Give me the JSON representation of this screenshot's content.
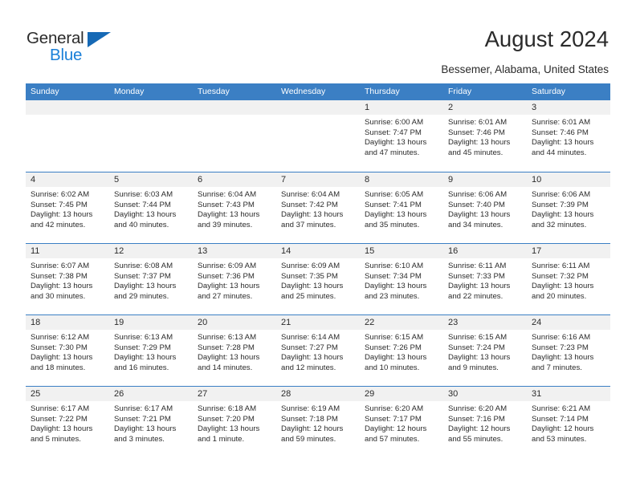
{
  "brand": {
    "name_top": "General",
    "name_bottom": "Blue",
    "triangle_color": "#1669b5",
    "blue_text_color": "#1b80d8"
  },
  "header": {
    "title": "August 2024",
    "subtitle": "Bessemer, Alabama, United States"
  },
  "theme": {
    "header_blue": "#3b7fc4",
    "day_band_gray": "#f1f1f1",
    "text": "#2b2b2b"
  },
  "weekdays": [
    "Sunday",
    "Monday",
    "Tuesday",
    "Wednesday",
    "Thursday",
    "Friday",
    "Saturday"
  ],
  "weeks": [
    [
      {
        "empty": true
      },
      {
        "empty": true
      },
      {
        "empty": true
      },
      {
        "empty": true
      },
      {
        "day": "1",
        "sunrise": "Sunrise: 6:00 AM",
        "sunset": "Sunset: 7:47 PM",
        "daylight1": "Daylight: 13 hours",
        "daylight2": "and 47 minutes."
      },
      {
        "day": "2",
        "sunrise": "Sunrise: 6:01 AM",
        "sunset": "Sunset: 7:46 PM",
        "daylight1": "Daylight: 13 hours",
        "daylight2": "and 45 minutes."
      },
      {
        "day": "3",
        "sunrise": "Sunrise: 6:01 AM",
        "sunset": "Sunset: 7:46 PM",
        "daylight1": "Daylight: 13 hours",
        "daylight2": "and 44 minutes."
      }
    ],
    [
      {
        "day": "4",
        "sunrise": "Sunrise: 6:02 AM",
        "sunset": "Sunset: 7:45 PM",
        "daylight1": "Daylight: 13 hours",
        "daylight2": "and 42 minutes."
      },
      {
        "day": "5",
        "sunrise": "Sunrise: 6:03 AM",
        "sunset": "Sunset: 7:44 PM",
        "daylight1": "Daylight: 13 hours",
        "daylight2": "and 40 minutes."
      },
      {
        "day": "6",
        "sunrise": "Sunrise: 6:04 AM",
        "sunset": "Sunset: 7:43 PM",
        "daylight1": "Daylight: 13 hours",
        "daylight2": "and 39 minutes."
      },
      {
        "day": "7",
        "sunrise": "Sunrise: 6:04 AM",
        "sunset": "Sunset: 7:42 PM",
        "daylight1": "Daylight: 13 hours",
        "daylight2": "and 37 minutes."
      },
      {
        "day": "8",
        "sunrise": "Sunrise: 6:05 AM",
        "sunset": "Sunset: 7:41 PM",
        "daylight1": "Daylight: 13 hours",
        "daylight2": "and 35 minutes."
      },
      {
        "day": "9",
        "sunrise": "Sunrise: 6:06 AM",
        "sunset": "Sunset: 7:40 PM",
        "daylight1": "Daylight: 13 hours",
        "daylight2": "and 34 minutes."
      },
      {
        "day": "10",
        "sunrise": "Sunrise: 6:06 AM",
        "sunset": "Sunset: 7:39 PM",
        "daylight1": "Daylight: 13 hours",
        "daylight2": "and 32 minutes."
      }
    ],
    [
      {
        "day": "11",
        "sunrise": "Sunrise: 6:07 AM",
        "sunset": "Sunset: 7:38 PM",
        "daylight1": "Daylight: 13 hours",
        "daylight2": "and 30 minutes."
      },
      {
        "day": "12",
        "sunrise": "Sunrise: 6:08 AM",
        "sunset": "Sunset: 7:37 PM",
        "daylight1": "Daylight: 13 hours",
        "daylight2": "and 29 minutes."
      },
      {
        "day": "13",
        "sunrise": "Sunrise: 6:09 AM",
        "sunset": "Sunset: 7:36 PM",
        "daylight1": "Daylight: 13 hours",
        "daylight2": "and 27 minutes."
      },
      {
        "day": "14",
        "sunrise": "Sunrise: 6:09 AM",
        "sunset": "Sunset: 7:35 PM",
        "daylight1": "Daylight: 13 hours",
        "daylight2": "and 25 minutes."
      },
      {
        "day": "15",
        "sunrise": "Sunrise: 6:10 AM",
        "sunset": "Sunset: 7:34 PM",
        "daylight1": "Daylight: 13 hours",
        "daylight2": "and 23 minutes."
      },
      {
        "day": "16",
        "sunrise": "Sunrise: 6:11 AM",
        "sunset": "Sunset: 7:33 PM",
        "daylight1": "Daylight: 13 hours",
        "daylight2": "and 22 minutes."
      },
      {
        "day": "17",
        "sunrise": "Sunrise: 6:11 AM",
        "sunset": "Sunset: 7:32 PM",
        "daylight1": "Daylight: 13 hours",
        "daylight2": "and 20 minutes."
      }
    ],
    [
      {
        "day": "18",
        "sunrise": "Sunrise: 6:12 AM",
        "sunset": "Sunset: 7:30 PM",
        "daylight1": "Daylight: 13 hours",
        "daylight2": "and 18 minutes."
      },
      {
        "day": "19",
        "sunrise": "Sunrise: 6:13 AM",
        "sunset": "Sunset: 7:29 PM",
        "daylight1": "Daylight: 13 hours",
        "daylight2": "and 16 minutes."
      },
      {
        "day": "20",
        "sunrise": "Sunrise: 6:13 AM",
        "sunset": "Sunset: 7:28 PM",
        "daylight1": "Daylight: 13 hours",
        "daylight2": "and 14 minutes."
      },
      {
        "day": "21",
        "sunrise": "Sunrise: 6:14 AM",
        "sunset": "Sunset: 7:27 PM",
        "daylight1": "Daylight: 13 hours",
        "daylight2": "and 12 minutes."
      },
      {
        "day": "22",
        "sunrise": "Sunrise: 6:15 AM",
        "sunset": "Sunset: 7:26 PM",
        "daylight1": "Daylight: 13 hours",
        "daylight2": "and 10 minutes."
      },
      {
        "day": "23",
        "sunrise": "Sunrise: 6:15 AM",
        "sunset": "Sunset: 7:24 PM",
        "daylight1": "Daylight: 13 hours",
        "daylight2": "and 9 minutes."
      },
      {
        "day": "24",
        "sunrise": "Sunrise: 6:16 AM",
        "sunset": "Sunset: 7:23 PM",
        "daylight1": "Daylight: 13 hours",
        "daylight2": "and 7 minutes."
      }
    ],
    [
      {
        "day": "25",
        "sunrise": "Sunrise: 6:17 AM",
        "sunset": "Sunset: 7:22 PM",
        "daylight1": "Daylight: 13 hours",
        "daylight2": "and 5 minutes."
      },
      {
        "day": "26",
        "sunrise": "Sunrise: 6:17 AM",
        "sunset": "Sunset: 7:21 PM",
        "daylight1": "Daylight: 13 hours",
        "daylight2": "and 3 minutes."
      },
      {
        "day": "27",
        "sunrise": "Sunrise: 6:18 AM",
        "sunset": "Sunset: 7:20 PM",
        "daylight1": "Daylight: 13 hours",
        "daylight2": "and 1 minute."
      },
      {
        "day": "28",
        "sunrise": "Sunrise: 6:19 AM",
        "sunset": "Sunset: 7:18 PM",
        "daylight1": "Daylight: 12 hours",
        "daylight2": "and 59 minutes."
      },
      {
        "day": "29",
        "sunrise": "Sunrise: 6:20 AM",
        "sunset": "Sunset: 7:17 PM",
        "daylight1": "Daylight: 12 hours",
        "daylight2": "and 57 minutes."
      },
      {
        "day": "30",
        "sunrise": "Sunrise: 6:20 AM",
        "sunset": "Sunset: 7:16 PM",
        "daylight1": "Daylight: 12 hours",
        "daylight2": "and 55 minutes."
      },
      {
        "day": "31",
        "sunrise": "Sunrise: 6:21 AM",
        "sunset": "Sunset: 7:14 PM",
        "daylight1": "Daylight: 12 hours",
        "daylight2": "and 53 minutes."
      }
    ]
  ]
}
